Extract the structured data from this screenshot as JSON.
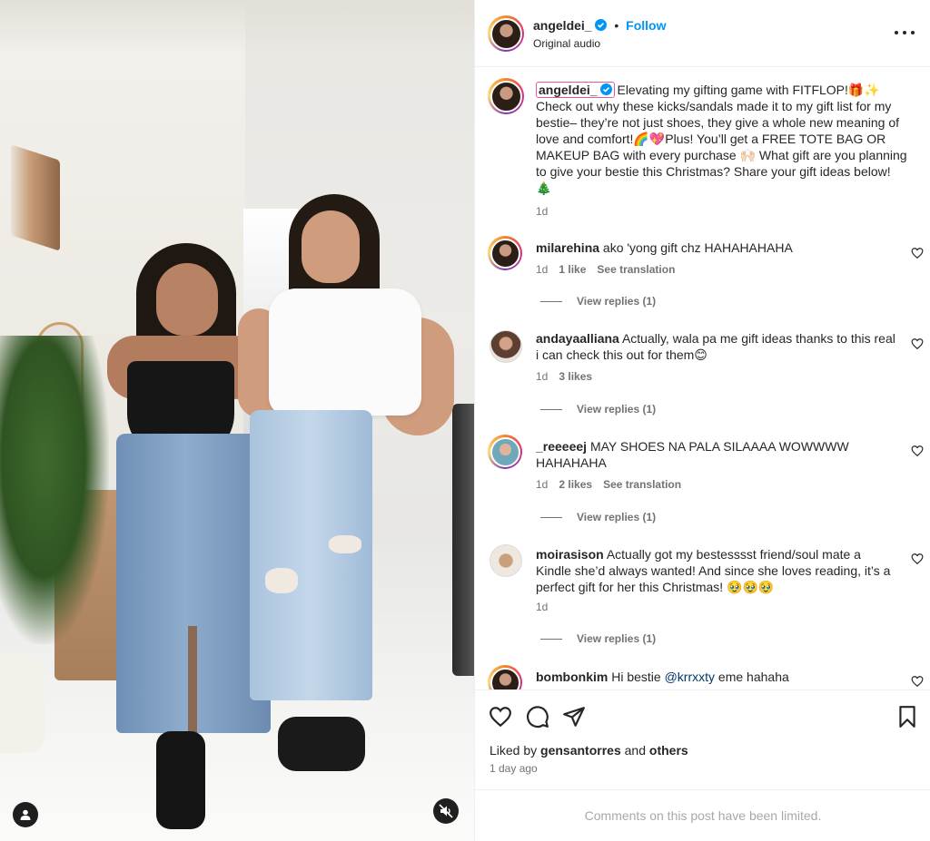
{
  "post": {
    "author": "angeldei_",
    "follow_label": "Follow",
    "separator": "•",
    "audio": "Original audio",
    "caption": "Elevating my gifting game with FITFLOP!🎁✨ Check out why these kicks/sandals made it to my gift list for my bestie– they’re not just shoes, they give a whole new meaning of love and comfort!🌈💖Plus! You’ll get a FREE TOTE BAG OR MAKEUP BAG with every purchase 🙌🏻 What gift are you planning to give your bestie this Christmas? Share your gift ideas below! 🎄",
    "caption_age": "1d"
  },
  "comments": [
    {
      "user": "milarehina",
      "text": "ako 'yong gift chz HAHAHAHAHA",
      "time": "1d",
      "likes": "1 like",
      "translate": "See translation",
      "replies": "View replies (1)"
    },
    {
      "user": "andayaalliana",
      "text": "Actually, wala pa me gift ideas thanks to this real i can check this out for them😊",
      "time": "1d",
      "likes": "3 likes",
      "translate": "",
      "replies": "View replies (1)"
    },
    {
      "user": "_reeeeej",
      "text": "MAY SHOES NA PALA SILAAAA WOWWWW HAHAHAHA",
      "time": "1d",
      "likes": "2 likes",
      "translate": "See translation",
      "replies": "View replies (1)"
    },
    {
      "user": "moirasison",
      "text": "Actually got my bestesssst friend/soul mate a Kindle she’d always wanted! And since she loves reading, it’s a perfect gift for her this Christmas! 🥹🥹🥹",
      "time": "1d",
      "likes": "",
      "translate": "",
      "replies": "View replies (1)"
    },
    {
      "user": "bombonkim",
      "text": "Hi bestie",
      "mention": "@krrxxty",
      "text_after": "eme hahaha"
    }
  ],
  "footer": {
    "liked_by_prefix": "Liked by",
    "liked_by_user": "gensantorres",
    "liked_by_and": "and",
    "liked_by_others": "others",
    "post_age": "1 day ago",
    "limited_notice": "Comments on this post have been limited."
  },
  "icons": {
    "verified": "verified-badge-icon",
    "more": "more-options-icon",
    "like": "heart-icon",
    "comment": "comment-icon",
    "share": "send-icon",
    "save": "bookmark-icon",
    "mute": "muted-speaker-icon",
    "tags": "user-tag-icon"
  },
  "colors": {
    "accent": "#0095f6",
    "text": "#262626",
    "secondary": "#737373",
    "mention": "#00376b"
  }
}
